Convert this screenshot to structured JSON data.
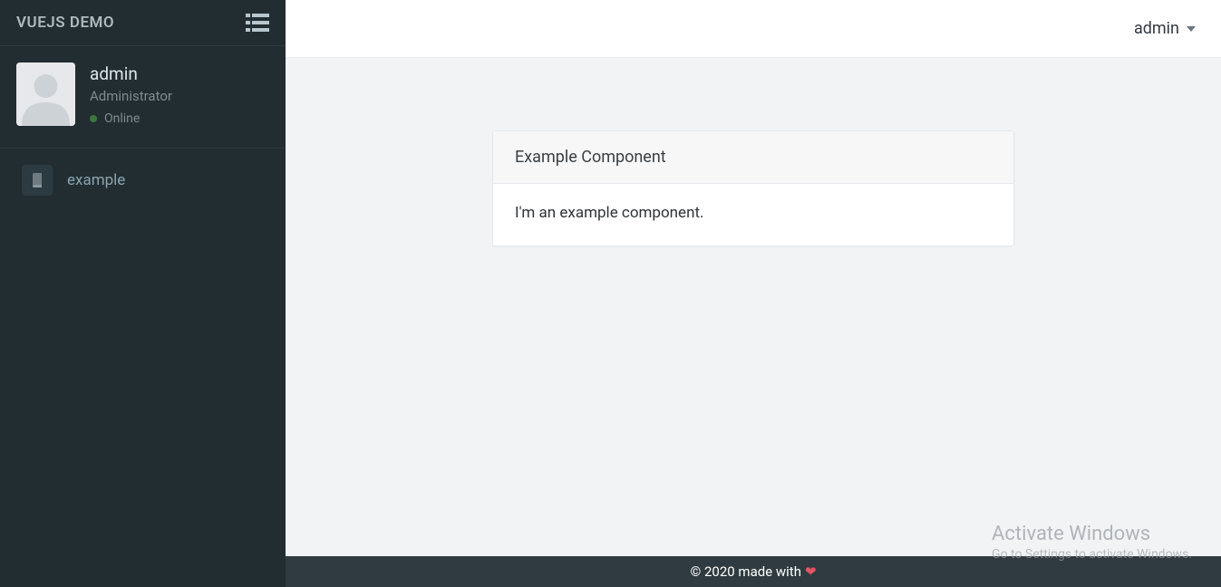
{
  "sidebar": {
    "title": "VUEJS DEMO",
    "user": {
      "name": "admin",
      "role": "Administrator",
      "status_label": "Online",
      "status_color": "#3c763d"
    },
    "nav": [
      {
        "icon": "book-icon",
        "label": "example"
      }
    ]
  },
  "header": {
    "user_menu_label": "admin"
  },
  "main": {
    "card": {
      "title": "Example Component",
      "body": "I'm an example component."
    }
  },
  "footer": {
    "text": "© 2020 made with",
    "heart": "❤"
  },
  "watermark": {
    "line1": "Activate Windows",
    "line2": "Go to Settings to activate Windows."
  }
}
